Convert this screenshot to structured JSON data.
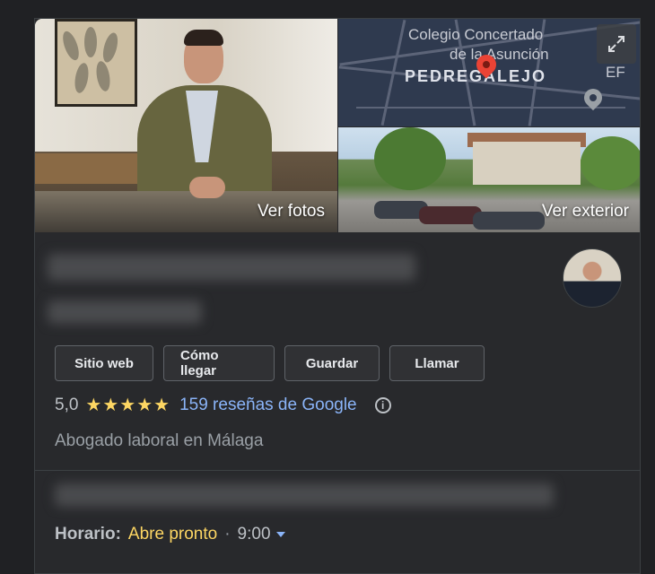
{
  "photos": {
    "main_label": "Ver fotos",
    "street_label": "Ver exterior"
  },
  "map": {
    "place_line1": "Colegio Concertado",
    "place_line2": "de la Asunción",
    "district": "PEDREGALEJO",
    "corner_label": "EF",
    "expand_icon": "expand-icon"
  },
  "actions": [
    {
      "label": "Sitio web"
    },
    {
      "label": "Cómo llegar"
    },
    {
      "label": "Guardar"
    },
    {
      "label": "Llamar"
    }
  ],
  "rating": {
    "value": "5,0",
    "stars": "★★★★★",
    "reviews_link": "159 reseñas de Google",
    "info_icon": "ⓘ"
  },
  "category": "Abogado laboral en Málaga",
  "hours": {
    "label": "Horario:",
    "status": "Abre pronto",
    "separator": "·",
    "time": "9:00"
  },
  "colors": {
    "background": "#202124",
    "panel": "#28292c",
    "link": "#8ab4f8",
    "star": "#fdd663",
    "status_open_soon": "#fdd663"
  }
}
